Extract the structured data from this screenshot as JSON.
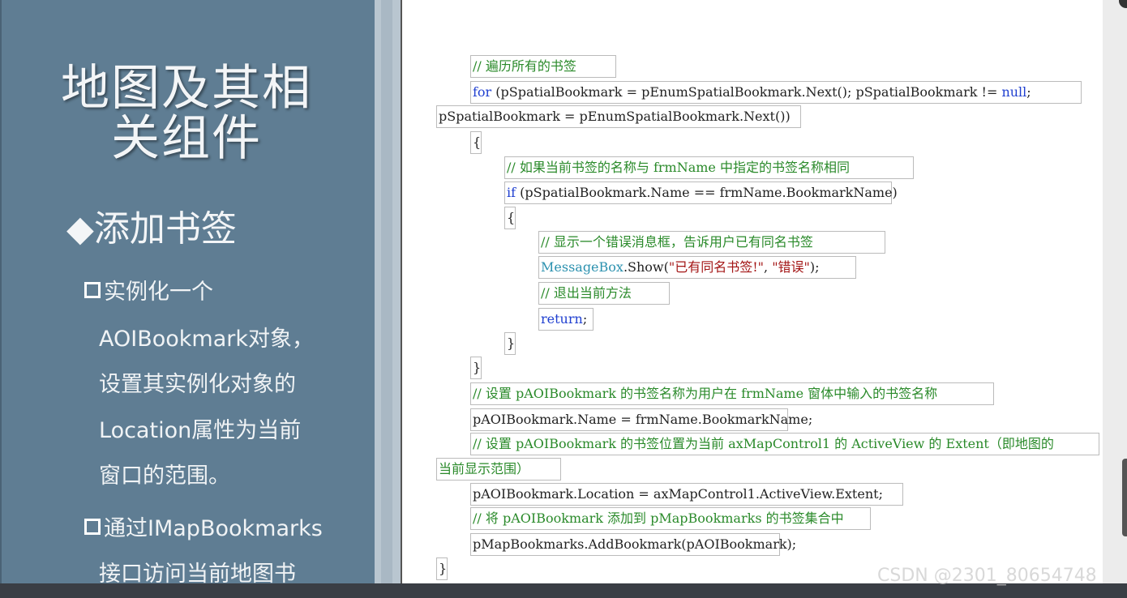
{
  "slide": {
    "title_line1": "地图及其相",
    "title_line2": "关组件",
    "section": "◆添加书签",
    "bullets": [
      "实例化一个",
      "AOIBookmark对象，",
      "设置其实例化对象的",
      "Location属性为当前",
      "窗口的范围。",
      "通过IMapBookmarks",
      "接口访问当前地图书"
    ]
  },
  "code": {
    "c1": "// 遍历所有的书签",
    "for_kw": "for",
    "for_rest": " (pSpatialBookmark = pEnumSpatialBookmark.Next(); pSpatialBookmark != ",
    "null_kw": "null",
    "for_end": ";",
    "for_line2": "pSpatialBookmark = pEnumSpatialBookmark.Next())",
    "brace_open1": "{",
    "c2": "// 如果当前书签的名称与 frmName 中指定的书签名称相同",
    "if_kw": "if",
    "if_rest": " (pSpatialBookmark.Name == frmName.BookmarkName)",
    "brace_open2": "{",
    "c3": "// 显示一个错误消息框，告诉用户已有同名书签",
    "msg_cls": "MessageBox",
    "msg_mid": ".Show(",
    "msg_str1": "\"已有同名书签!\"",
    "msg_comma": ", ",
    "msg_str2": "\"错误\"",
    "msg_end": ");",
    "c4": "// 退出当前方法",
    "return_kw": "return",
    "return_end": ";",
    "brace_close2": "}",
    "brace_close1": "}",
    "c5": "// 设置 pAOIBookmark 的书签名称为用户在 frmName 窗体中输入的书签名称",
    "assign_name": "pAOIBookmark.Name = frmName.BookmarkName;",
    "c6_line1": "// 设置 pAOIBookmark 的书签位置为当前 axMapControl1 的 ActiveView 的 Extent（即地图的",
    "c6_line2": "当前显示范围）",
    "assign_loc": "pAOIBookmark.Location = axMapControl1.ActiveView.Extent;",
    "c7": "// 将 pAOIBookmark 添加到 pMapBookmarks 的书签集合中",
    "add_line": "pMapBookmarks.AddBookmark(pAOIBookmark);",
    "brace_close0": "}"
  },
  "watermark": "CSDN @2301_80654748"
}
